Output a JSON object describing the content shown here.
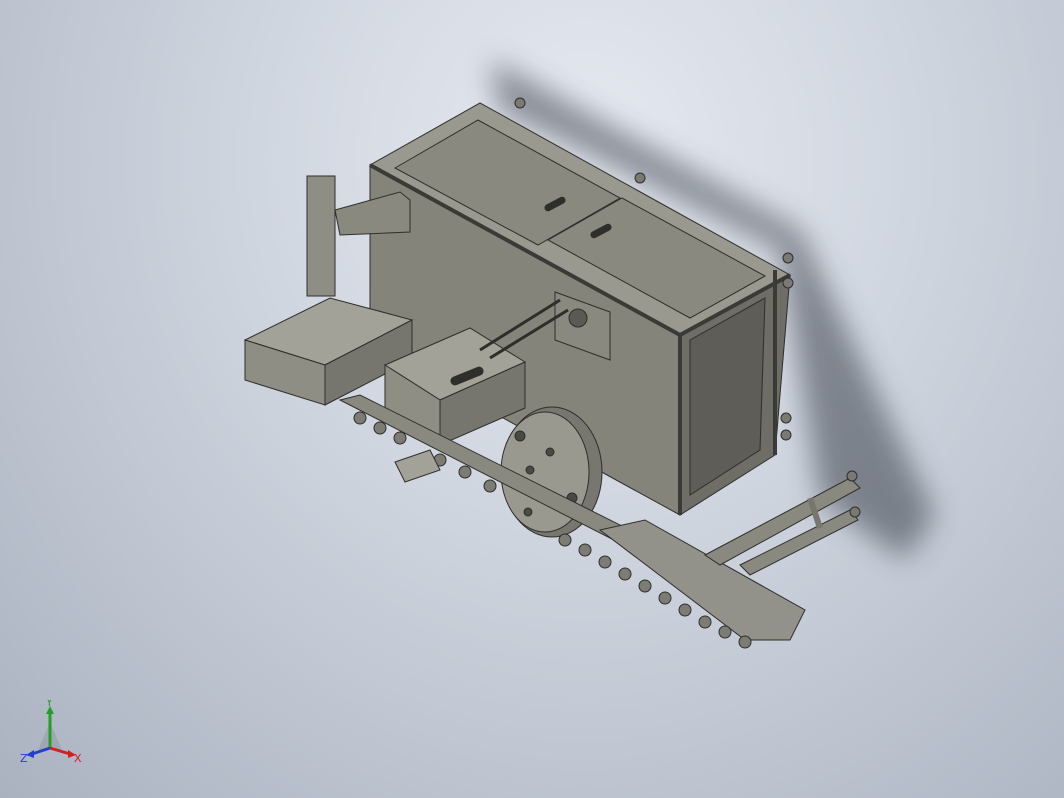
{
  "triad": {
    "x_label": "X",
    "y_label": "Y",
    "z_label": "Z"
  },
  "colors": {
    "x_axis": "#d22020",
    "y_axis": "#23a023",
    "z_axis": "#2040d0",
    "body": "#8d8c83",
    "body_dark": "#6f6e67",
    "body_light": "#a9a89e",
    "edge": "#2e2e2b"
  }
}
